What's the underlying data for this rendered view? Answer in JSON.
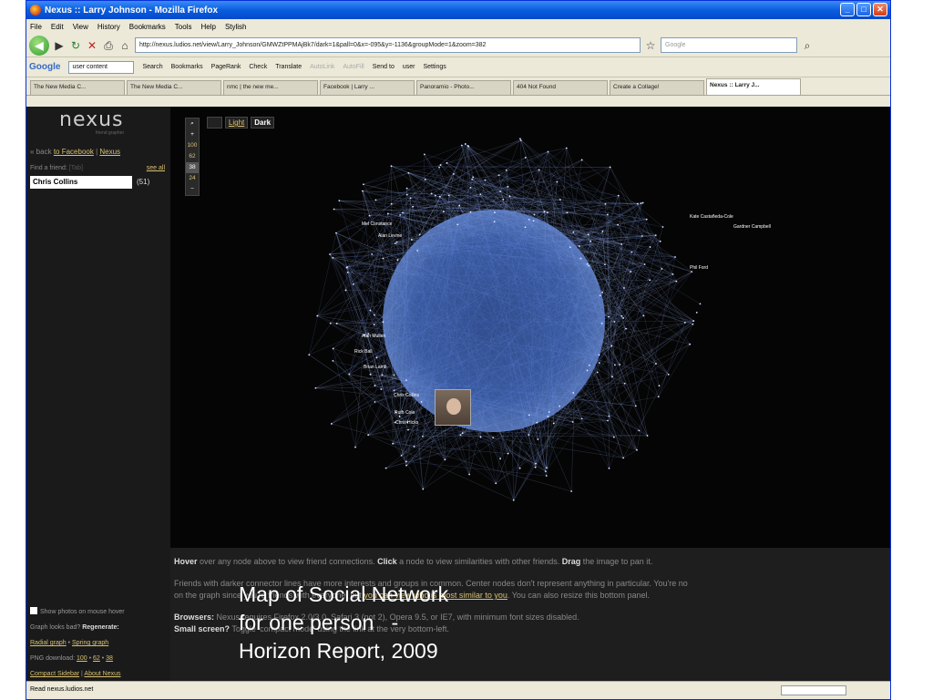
{
  "window": {
    "title": "Nexus :: Larry Johnson - Mozilla Firefox"
  },
  "menu": [
    "File",
    "Edit",
    "View",
    "History",
    "Bookmarks",
    "Tools",
    "Help",
    "Stylish"
  ],
  "nav": {
    "url": "http://nexus.ludios.net/view/Larry_Johnson/GMWZtPPMAjBk7/dark=1&pall=0&x=-095&y=-1136&groupMode=1&zoom=382",
    "search_placeholder": "Google"
  },
  "google_toolbar": {
    "logo": "Google",
    "box_value": "user content",
    "items": [
      "Search",
      "Bookmarks",
      "PageRank",
      "Check",
      "Translate",
      "AutoLink",
      "AutoFill",
      "Send to",
      "user",
      "Settings"
    ]
  },
  "tabs": [
    {
      "label": "The New Media C..."
    },
    {
      "label": "The New Media C..."
    },
    {
      "label": "nmc | the new me..."
    },
    {
      "label": "Facebook | Larry ..."
    },
    {
      "label": "Panoramio - Photo..."
    },
    {
      "label": "404 Not Found"
    },
    {
      "label": "Create a Collage!"
    },
    {
      "label": "Nexus :: Larry J..."
    }
  ],
  "sidebar": {
    "logo": "nexus",
    "logo_sub": "friend grapher",
    "back_prefix": "« back",
    "back_link": "to Facebook",
    "back_sep": " | ",
    "nexus_link": "Nexus",
    "find_label": "Find a friend:",
    "find_hint": "[Tab]",
    "see_all": "see all",
    "find_value": "Chris Collins",
    "find_count": "(51)",
    "show_photos": "Show photos on mouse hover",
    "graph_bad": "Graph looks bad?",
    "regenerate": "Regenerate:",
    "radial": "Radial graph",
    "spring": "Spring graph",
    "png_label": "PNG download:",
    "png_100": "100",
    "png_62": "62",
    "png_38": "38",
    "compact": "Compact Sidebar",
    "about": "About Nexus"
  },
  "graph": {
    "zoom_levels": [
      "100",
      "62",
      "38",
      "24"
    ],
    "toggle_light": "Light",
    "toggle_dark": "Dark",
    "node_labels": [
      "Kate Castañeda-Cole",
      "Gardner Campbell",
      "Phil Ford",
      "Mel Constance",
      "Alan Levine",
      "Rick Ball",
      "Alan Mullen",
      "Brian Lamb",
      "Chris Hicks",
      "Chris Collins",
      "Ruth Cole"
    ]
  },
  "caption": "Map of Social Network\nfor one person   -\nHorizon Report, 2009",
  "info": {
    "hover_bold": "Hover",
    "hover_text": " over any node above to view friend connections. ",
    "click_bold": "Click",
    "click_text": " a node to view similarities with other friends. ",
    "drag_bold": "Drag",
    "drag_text": " the image to pan it.",
    "line2a": "Friends with darker connector lines have more interests and groups in common. Center nodes don't represent anything in particular. You're no",
    "line2b": "on the graph since you're friends with everyone, but ",
    "line2_link": "you can view who is most similar to you",
    "line2c": ". You can also resize this bottom panel.",
    "browsers_bold": "Browsers:",
    "browsers_text": " Nexus requires Firefox 2.0/3.0, Safari 3 (not 2), Opera 9.5, or IE7, with minimum font sizes disabled.",
    "small_bold": "Small screen?",
    "small_text": " Toggle 'compact mode' using the link at the very bottom-left."
  },
  "status": {
    "text": "Read nexus.ludios.net"
  }
}
